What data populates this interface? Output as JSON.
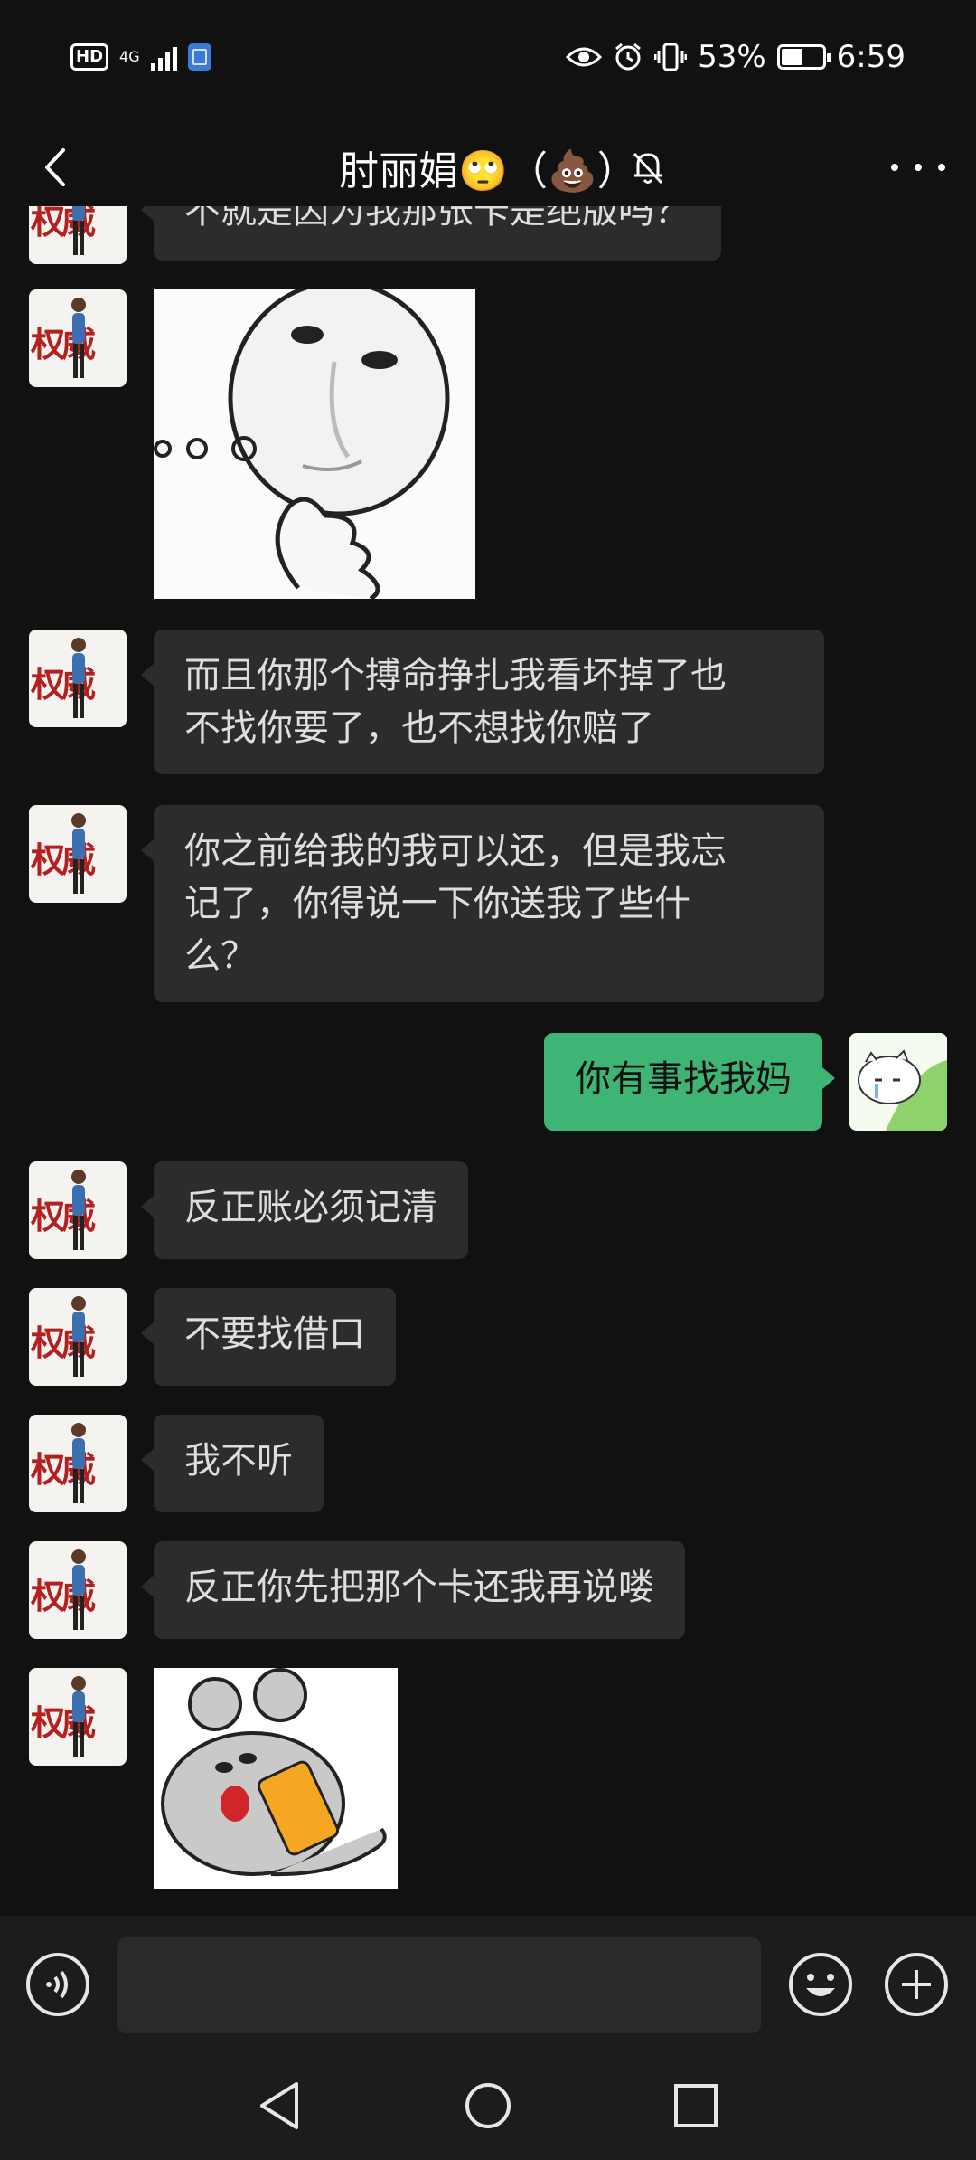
{
  "status_bar": {
    "hd": "HD",
    "network": "4G",
    "battery_percent": "53%",
    "battery_level": 0.53,
    "time": "6:59"
  },
  "header": {
    "title": "肘丽娟🙄（💩）"
  },
  "avatar_text": "权威",
  "messages": [
    {
      "from": "them",
      "type": "text",
      "text": "不就是因为我那张卡是绝版吗？"
    },
    {
      "from": "them",
      "type": "image",
      "icon": "thinking-face-sticker"
    },
    {
      "from": "them",
      "type": "text",
      "lines": [
        "而且你那个搏命挣扎我看坏掉了也",
        "不找你要了，也不想找你赔了"
      ]
    },
    {
      "from": "them",
      "type": "text",
      "lines": [
        "你之前给我的我可以还，但是我忘",
        "记了，你得说一下你送我了些什",
        "么？"
      ]
    },
    {
      "from": "me",
      "type": "text",
      "text": "你有事找我妈"
    },
    {
      "from": "them",
      "type": "text",
      "text": "反正账必须记清"
    },
    {
      "from": "them",
      "type": "text",
      "text": "不要找借口"
    },
    {
      "from": "them",
      "type": "text",
      "text": "我不听"
    },
    {
      "from": "them",
      "type": "text",
      "text": "反正你先把那个卡还我再说喽"
    },
    {
      "from": "them",
      "type": "image",
      "icon": "mouse-sticker"
    }
  ],
  "icons": {
    "back": "back-chevron-icon",
    "mute": "bell-off-icon",
    "more": "more-dots-icon",
    "voice": "voice-icon",
    "emoji": "emoji-icon",
    "plus": "plus-icon"
  },
  "colors": {
    "background": "#111111",
    "incoming_bubble": "#2c2c2c",
    "outgoing_bubble": "#3eb575",
    "avatar_text": "#b3201f"
  }
}
